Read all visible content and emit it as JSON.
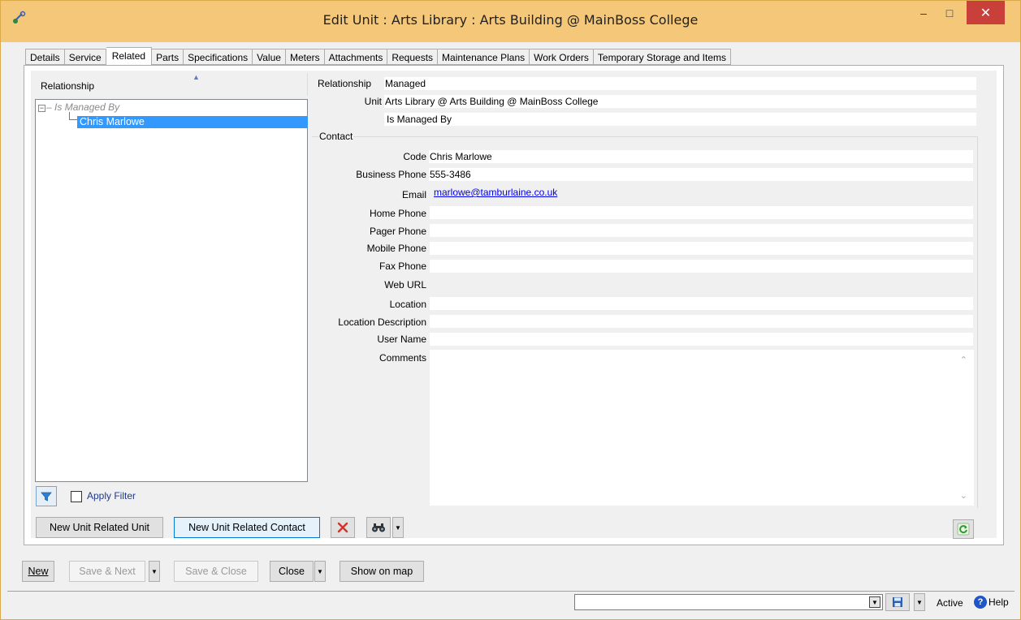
{
  "window": {
    "title": "Edit Unit : Arts Library : Arts Building @ MainBoss College",
    "minimize_glyph": "–",
    "maximize_glyph": "□",
    "close_glyph": "✕"
  },
  "tabs": [
    {
      "label": "Details"
    },
    {
      "label": "Service"
    },
    {
      "label": "Related"
    },
    {
      "label": "Parts"
    },
    {
      "label": "Specifications"
    },
    {
      "label": "Value"
    },
    {
      "label": "Meters"
    },
    {
      "label": "Attachments"
    },
    {
      "label": "Requests"
    },
    {
      "label": "Maintenance Plans"
    },
    {
      "label": "Work Orders"
    },
    {
      "label": "Temporary Storage and Items"
    }
  ],
  "tree": {
    "header": "Relationship",
    "group_label": "Is Managed By",
    "selected_item": "Chris Marlowe"
  },
  "filter": {
    "label": "Apply Filter",
    "checked": false
  },
  "form": {
    "relationship_label": "Relationship",
    "relationship_value": "Managed",
    "unit_label": "Unit",
    "unit_value": "Arts Library @ Arts Building @ MainBoss College",
    "relation_text": "Is Managed By",
    "contact_group_label": "Contact",
    "code_label": "Code",
    "code_value": "Chris Marlowe",
    "business_phone_label": "Business Phone",
    "business_phone_value": "555-3486",
    "email_label": "Email",
    "email_value": "marlowe@tamburlaine.co.uk",
    "home_phone_label": "Home Phone",
    "home_phone_value": "",
    "pager_phone_label": "Pager Phone",
    "pager_phone_value": "",
    "mobile_phone_label": "Mobile Phone",
    "mobile_phone_value": "",
    "fax_phone_label": "Fax Phone",
    "fax_phone_value": "",
    "web_url_label": "Web URL",
    "web_url_value": "",
    "location_label": "Location",
    "location_value": "",
    "location_description_label": "Location Description",
    "location_description_value": "",
    "user_name_label": "User Name",
    "user_name_value": "",
    "comments_label": "Comments",
    "comments_value": ""
  },
  "panel_buttons": {
    "new_related_unit": "New Unit Related Unit",
    "new_related_contact": "New Unit Related Contact"
  },
  "footer_buttons": {
    "new": "New",
    "save_next": "Save & Next",
    "save_close": "Save & Close",
    "close": "Close",
    "show_on_map": "Show on map"
  },
  "status": {
    "combo_value": "",
    "active_label": "Active",
    "help_label": "Help"
  },
  "colors": {
    "titlebar": "#f4c779",
    "selection": "#3399ff",
    "close_button": "#c9403a",
    "link": "#0000ee"
  }
}
